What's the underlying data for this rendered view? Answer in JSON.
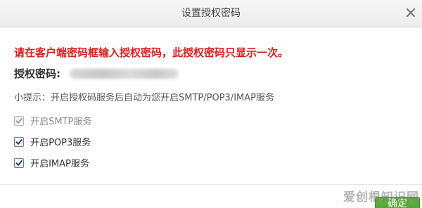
{
  "dialog": {
    "title": "设置授权密码",
    "close_symbol": "×"
  },
  "content": {
    "warning": "请在客户端密码框输入授权密码，此授权密码只显示一次。",
    "auth_label": "授权密码:",
    "hint": "小提示：开启授权码服务后自动为您开启SMTP/POP3/IMAP服务",
    "options": [
      {
        "label": "开启SMTP服务",
        "checked": true,
        "disabled": true
      },
      {
        "label": "开启POP3服务",
        "checked": true,
        "disabled": false
      },
      {
        "label": "开启IMAP服务",
        "checked": true,
        "disabled": false
      }
    ]
  },
  "footer": {
    "confirm_label": "确定"
  },
  "watermark": {
    "text": "爱创根知识网"
  },
  "colors": {
    "warning": "#d81e1e",
    "confirm": "#4aa82e"
  }
}
